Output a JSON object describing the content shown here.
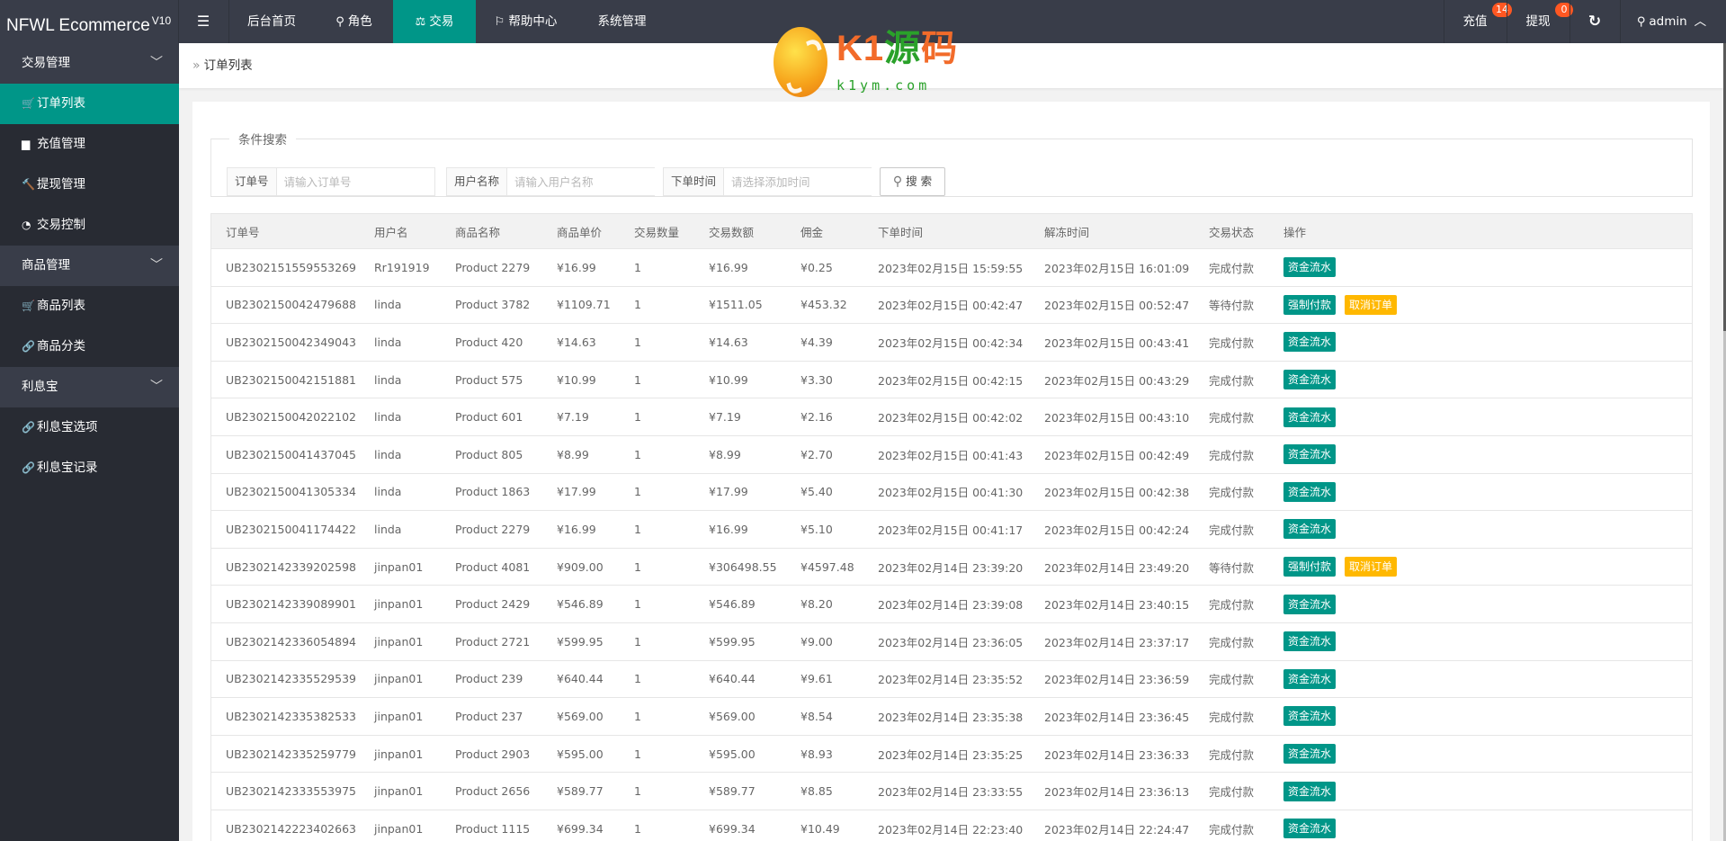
{
  "header": {
    "logo": "NFWL Ecommerce",
    "logo_version": "V10",
    "toggle_icon": "menu-toggle-icon",
    "nav": [
      {
        "label": "后台首页",
        "icon": ""
      },
      {
        "label": "角色",
        "icon": "user-icon"
      },
      {
        "label": "交易",
        "icon": "scale-icon",
        "active": true
      },
      {
        "label": "帮助中心",
        "icon": "flag-icon"
      },
      {
        "label": "系统管理",
        "icon": ""
      }
    ],
    "recharge": {
      "label": "充值",
      "badge": "14"
    },
    "withdraw": {
      "label": "提现",
      "badge": "0"
    },
    "refresh_icon": "refresh-icon",
    "user": {
      "name": "admin"
    }
  },
  "sidebar": {
    "groups": [
      {
        "label": "交易管理",
        "items": [
          {
            "label": "订单列表",
            "icon": "cart-icon",
            "active": true
          },
          {
            "label": "充值管理",
            "icon": "monitor-icon"
          },
          {
            "label": "提现管理",
            "icon": "gavel-icon"
          },
          {
            "label": "交易控制",
            "icon": "gauge-icon"
          }
        ]
      },
      {
        "label": "商品管理",
        "items": [
          {
            "label": "商品列表",
            "icon": "cart-icon"
          },
          {
            "label": "商品分类",
            "icon": "link-icon"
          }
        ]
      },
      {
        "label": "利息宝",
        "items": [
          {
            "label": "利息宝选项",
            "icon": "link-icon"
          },
          {
            "label": "利息宝记录",
            "icon": "link-icon"
          }
        ]
      }
    ]
  },
  "breadcrumb": {
    "current": "订单列表"
  },
  "watermark": {
    "brand": "K1源码",
    "url": "k1ym.com"
  },
  "search": {
    "legend": "条件搜索",
    "fields": [
      {
        "label": "订单号",
        "placeholder": "请输入订单号",
        "value": ""
      },
      {
        "label": "用户名称",
        "placeholder": "请输入用户名称",
        "value": ""
      },
      {
        "label": "下单时间",
        "placeholder": "请选择添加时间",
        "value": ""
      }
    ],
    "button": "搜 索"
  },
  "table": {
    "columns": [
      "订单号",
      "用户名",
      "商品名称",
      "商品单价",
      "交易数量",
      "交易数额",
      "佣金",
      "下单时间",
      "解冻时间",
      "交易状态",
      "操作"
    ],
    "actions": {
      "flow": "资金流水",
      "force_pay": "强制付款",
      "cancel": "取消订单"
    },
    "rows": [
      [
        "UB2302151559553269",
        "Rr191919",
        "Product 2279",
        "¥16.99",
        "1",
        "¥16.99",
        "¥0.25",
        "2023年02月15日 15:59:55",
        "2023年02月15日 16:01:09",
        "完成付款"
      ],
      [
        "UB2302150042479688",
        "linda",
        "Product 3782",
        "¥1109.71",
        "1",
        "¥1511.05",
        "¥453.32",
        "2023年02月15日 00:42:47",
        "2023年02月15日 00:52:47",
        "等待付款"
      ],
      [
        "UB2302150042349043",
        "linda",
        "Product 420",
        "¥14.63",
        "1",
        "¥14.63",
        "¥4.39",
        "2023年02月15日 00:42:34",
        "2023年02月15日 00:43:41",
        "完成付款"
      ],
      [
        "UB2302150042151881",
        "linda",
        "Product 575",
        "¥10.99",
        "1",
        "¥10.99",
        "¥3.30",
        "2023年02月15日 00:42:15",
        "2023年02月15日 00:43:29",
        "完成付款"
      ],
      [
        "UB2302150042022102",
        "linda",
        "Product 601",
        "¥7.19",
        "1",
        "¥7.19",
        "¥2.16",
        "2023年02月15日 00:42:02",
        "2023年02月15日 00:43:10",
        "完成付款"
      ],
      [
        "UB2302150041437045",
        "linda",
        "Product 805",
        "¥8.99",
        "1",
        "¥8.99",
        "¥2.70",
        "2023年02月15日 00:41:43",
        "2023年02月15日 00:42:49",
        "完成付款"
      ],
      [
        "UB2302150041305334",
        "linda",
        "Product 1863",
        "¥17.99",
        "1",
        "¥17.99",
        "¥5.40",
        "2023年02月15日 00:41:30",
        "2023年02月15日 00:42:38",
        "完成付款"
      ],
      [
        "UB2302150041174422",
        "linda",
        "Product 2279",
        "¥16.99",
        "1",
        "¥16.99",
        "¥5.10",
        "2023年02月15日 00:41:17",
        "2023年02月15日 00:42:24",
        "完成付款"
      ],
      [
        "UB2302142339202598",
        "jinpan01",
        "Product 4081",
        "¥909.00",
        "1",
        "¥306498.55",
        "¥4597.48",
        "2023年02月14日 23:39:20",
        "2023年02月14日 23:49:20",
        "等待付款"
      ],
      [
        "UB2302142339089901",
        "jinpan01",
        "Product 2429",
        "¥546.89",
        "1",
        "¥546.89",
        "¥8.20",
        "2023年02月14日 23:39:08",
        "2023年02月14日 23:40:15",
        "完成付款"
      ],
      [
        "UB2302142336054894",
        "jinpan01",
        "Product 2721",
        "¥599.95",
        "1",
        "¥599.95",
        "¥9.00",
        "2023年02月14日 23:36:05",
        "2023年02月14日 23:37:17",
        "完成付款"
      ],
      [
        "UB2302142335529539",
        "jinpan01",
        "Product 239",
        "¥640.44",
        "1",
        "¥640.44",
        "¥9.61",
        "2023年02月14日 23:35:52",
        "2023年02月14日 23:36:59",
        "完成付款"
      ],
      [
        "UB2302142335382533",
        "jinpan01",
        "Product 237",
        "¥569.00",
        "1",
        "¥569.00",
        "¥8.54",
        "2023年02月14日 23:35:38",
        "2023年02月14日 23:36:45",
        "完成付款"
      ],
      [
        "UB2302142335259779",
        "jinpan01",
        "Product 2903",
        "¥595.00",
        "1",
        "¥595.00",
        "¥8.93",
        "2023年02月14日 23:35:25",
        "2023年02月14日 23:36:33",
        "完成付款"
      ],
      [
        "UB2302142333553975",
        "jinpan01",
        "Product 2656",
        "¥589.77",
        "1",
        "¥589.77",
        "¥8.85",
        "2023年02月14日 23:33:55",
        "2023年02月14日 23:36:13",
        "完成付款"
      ],
      [
        "UB2302142223402663",
        "jinpan01",
        "Product 1115",
        "¥699.34",
        "1",
        "¥699.34",
        "¥10.49",
        "2023年02月14日 22:23:40",
        "2023年02月14日 22:24:47",
        "完成付款"
      ]
    ]
  },
  "colors": {
    "accent": "#009688",
    "header_bg": "#393d49",
    "sidebar_bg": "#282b33",
    "warn": "#ffb800",
    "badge": "#ff5722"
  }
}
